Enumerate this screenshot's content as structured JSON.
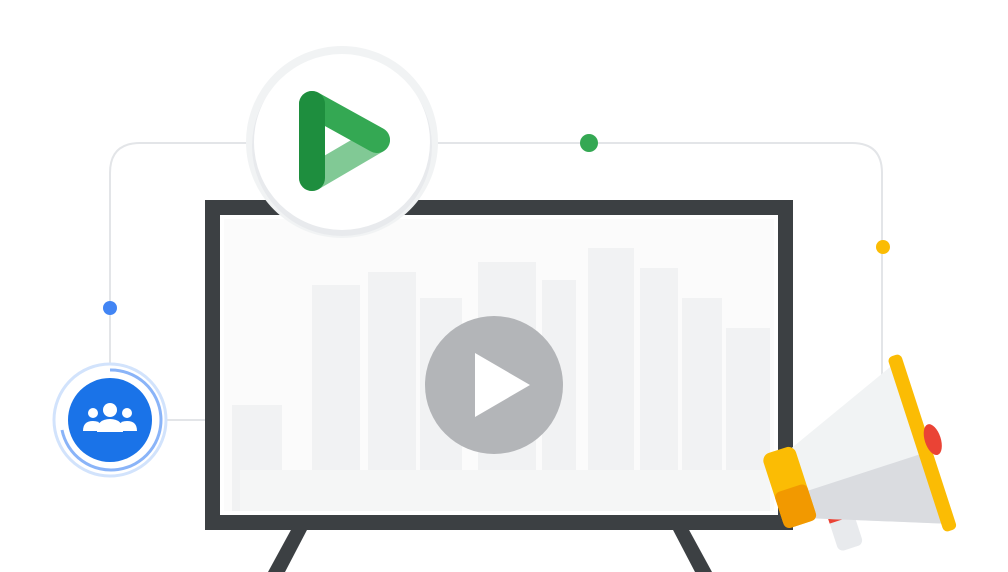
{
  "illustration": {
    "icons": {
      "brand": "green-play-logo-icon",
      "audience": "audience-group-icon",
      "video": "video-play-icon",
      "announcement": "megaphone-icon"
    },
    "colors": {
      "background": "#ffffff",
      "connector": "#e3e5e8",
      "tv_frame": "#3c4043",
      "screen": "#ffffff",
      "skyline": "#f1f2f3",
      "play_disc": "#b3b5b8",
      "brand_green_dark": "#1e8e3e",
      "brand_green_mid": "#34a853",
      "brand_green_light": "#81c995",
      "dot_green": "#34a853",
      "dot_blue": "#4285f4",
      "dot_yellow": "#fbbc04",
      "audience_blue": "#1a73e8",
      "megaphone_body": "#f1f3f4",
      "megaphone_handle": "#fbbc04",
      "megaphone_red": "#ea4335"
    }
  }
}
